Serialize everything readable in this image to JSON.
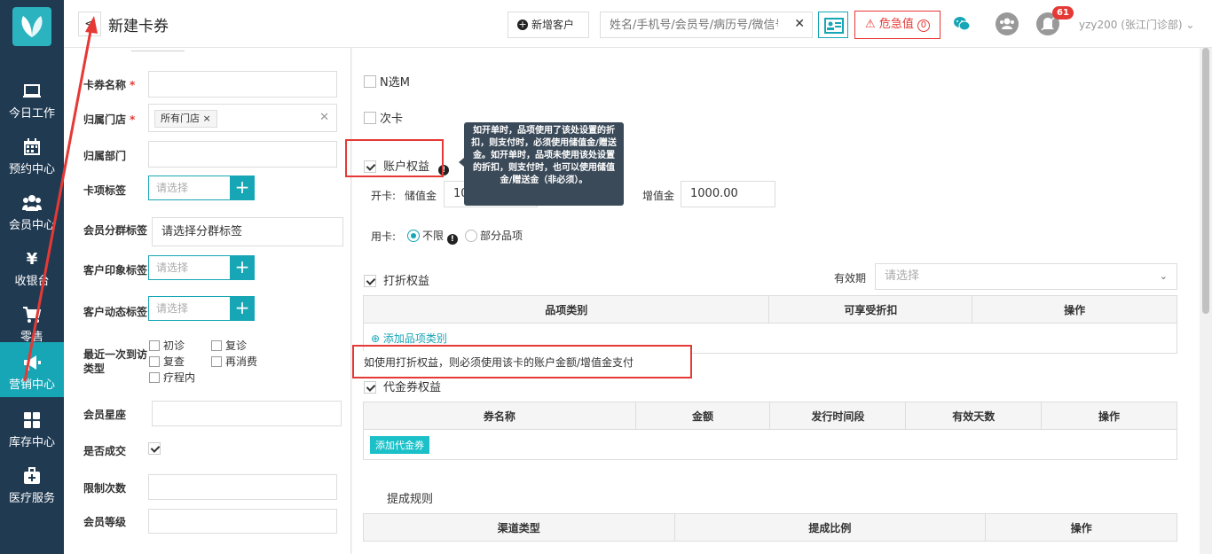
{
  "nav": {
    "items": [
      {
        "label": "今日工作",
        "icon": "monitor-icon"
      },
      {
        "label": "预约中心",
        "icon": "calendar-icon"
      },
      {
        "label": "会员中心",
        "icon": "users-icon"
      },
      {
        "label": "收银台",
        "icon": "yen-icon"
      },
      {
        "label": "零售",
        "icon": "cart-icon"
      },
      {
        "label": "营销中心",
        "icon": "megaphone-icon",
        "active": true
      },
      {
        "label": "库存中心",
        "icon": "grid-icon"
      },
      {
        "label": "医疗服务",
        "icon": "medkit-icon"
      }
    ]
  },
  "header": {
    "title": "新建卡券",
    "back": "<",
    "add_customer": "新增客户",
    "search_placeholder": "姓名/手机号/会员号/病历号/微信号",
    "search_clear": "✕",
    "critical": "危急值",
    "critical_count": "0",
    "badge": "61",
    "user": "yzy200 (张江门诊部)"
  },
  "form": {
    "card_name": "卡券名称",
    "required": "*",
    "store": "归属门店",
    "store_tag": "所有门店",
    "tag_remove": "×",
    "clear": "✕",
    "dept": "归属部门",
    "card_tag": "卡项标签",
    "select_placeholder": "请选择",
    "plus": "+",
    "member_group": "会员分群标签",
    "member_group_placeholder": "请选择分群标签",
    "impression": "客户印象标签",
    "dynamic": "客户动态标签",
    "visit_type_l1": "最近一次到访",
    "visit_type_l2": "类型",
    "visit_options": [
      "初诊",
      "复诊",
      "复查",
      "再消费",
      "疗程内"
    ],
    "member_star": "会员星座",
    "is_deal": "是否成交",
    "limit_count": "限制次数",
    "member_level": "会员等级"
  },
  "right": {
    "n_of_m": "N选M",
    "times_card": "次卡",
    "account_benefit": "账户权益",
    "info": "!",
    "tooltip": "如开单时，品项使用了该处设置的折扣，则支付时，必须使用储值金/赠送金。如开单时，品项未使用该处设置的折扣，则支付时，也可以使用储值金/赠送金（非必须）。",
    "open_card": "开卡:",
    "stored_value": "储值金",
    "stored_amount": "10000.00",
    "gift_value": "增值金",
    "gift_amount": "1000.00",
    "use_card": "用卡:",
    "unlimited": "不限",
    "partial": "部分品项",
    "discount_benefit": "打折权益",
    "validity": "有效期",
    "validity_placeholder": "请选择",
    "discount_table": {
      "headers": [
        "品项类别",
        "可享受折扣",
        "操作"
      ],
      "add": "添加品项类别"
    },
    "discount_note": "如使用打折权益，则必须使用该卡的账户金额/增值金支付",
    "voucher_benefit": "代金券权益",
    "voucher_table": {
      "headers": [
        "券名称",
        "金额",
        "发行时间段",
        "有效天数",
        "操作"
      ],
      "add": "添加代金券"
    },
    "commission": "提成规则",
    "commission_table": {
      "headers": [
        "渠道类型",
        "提成比例",
        "操作"
      ]
    }
  },
  "colors": {
    "sidebar": "#203a52",
    "accent": "#17a6b6",
    "alert": "#e53935"
  }
}
